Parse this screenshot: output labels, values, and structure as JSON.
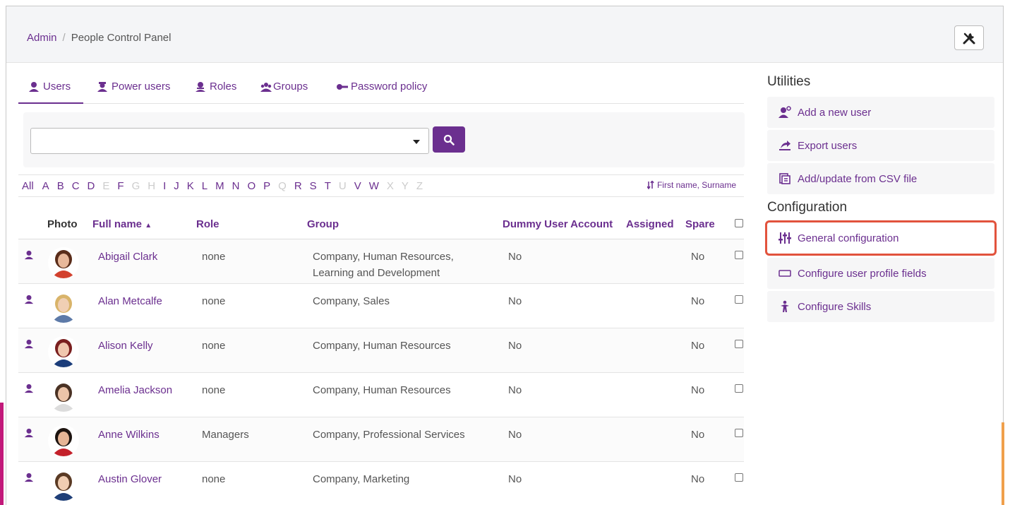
{
  "breadcrumb": {
    "root": "Admin",
    "separator": "/",
    "current": "People Control Panel"
  },
  "tabs": [
    {
      "label": "Users",
      "icon": "user-icon",
      "active": true
    },
    {
      "label": "Power users",
      "icon": "power-user-icon"
    },
    {
      "label": "Roles",
      "icon": "role-icon"
    },
    {
      "label": "Groups",
      "icon": "groups-icon"
    },
    {
      "label": "Password policy",
      "icon": "key-icon"
    }
  ],
  "search": {
    "value": ""
  },
  "alphabet": {
    "all": "All",
    "letters": [
      {
        "l": "A",
        "on": true
      },
      {
        "l": "B",
        "on": true
      },
      {
        "l": "C",
        "on": true
      },
      {
        "l": "D",
        "on": true
      },
      {
        "l": "E",
        "on": false
      },
      {
        "l": "F",
        "on": true
      },
      {
        "l": "G",
        "on": false
      },
      {
        "l": "H",
        "on": false
      },
      {
        "l": "I",
        "on": true
      },
      {
        "l": "J",
        "on": true
      },
      {
        "l": "K",
        "on": true
      },
      {
        "l": "L",
        "on": true
      },
      {
        "l": "M",
        "on": true
      },
      {
        "l": "N",
        "on": true
      },
      {
        "l": "O",
        "on": true
      },
      {
        "l": "P",
        "on": true
      },
      {
        "l": "Q",
        "on": false
      },
      {
        "l": "R",
        "on": true
      },
      {
        "l": "S",
        "on": true
      },
      {
        "l": "T",
        "on": true
      },
      {
        "l": "U",
        "on": false
      },
      {
        "l": "V",
        "on": true
      },
      {
        "l": "W",
        "on": true
      },
      {
        "l": "X",
        "on": false
      },
      {
        "l": "Y",
        "on": false
      },
      {
        "l": "Z",
        "on": false
      }
    ],
    "sort_label": "First name, Surname"
  },
  "table": {
    "headers": {
      "photo": "Photo",
      "full_name": "Full name",
      "role": "Role",
      "group": "Group",
      "dummy": "Dummy User Account",
      "assigned": "Assigned",
      "spare": "Spare"
    },
    "rows": [
      {
        "name": "Abigail Clark",
        "role": "none",
        "group": "Company, Human Resources,",
        "group2": "Learning and Development",
        "dummy": "No",
        "assigned": "",
        "spare": "No",
        "hair": "#5a2d1a",
        "skin": "#e8b89a",
        "shirt": "#d2412e"
      },
      {
        "name": "Alan Metcalfe",
        "role": "none",
        "group": "Company, Sales",
        "group2": "",
        "dummy": "No",
        "assigned": "",
        "spare": "No",
        "hair": "#d9b46a",
        "skin": "#f0cfb4",
        "shirt": "#5d7aa8"
      },
      {
        "name": "Alison Kelly",
        "role": "none",
        "group": "Company, Human Resources",
        "group2": "",
        "dummy": "No",
        "assigned": "",
        "spare": "No",
        "hair": "#7a1f1f",
        "skin": "#f0c7ae",
        "shirt": "#1b3d7a"
      },
      {
        "name": "Amelia Jackson",
        "role": "none",
        "group": "Company, Human Resources",
        "group2": "",
        "dummy": "No",
        "assigned": "",
        "spare": "No",
        "hair": "#4a3224",
        "skin": "#ecc4a8",
        "shirt": "#dcdcdc"
      },
      {
        "name": "Anne Wilkins",
        "role": "Managers",
        "group": "Company, Professional Services",
        "group2": "",
        "dummy": "No",
        "assigned": "",
        "spare": "No",
        "hair": "#1d1410",
        "skin": "#e6b596",
        "shirt": "#c3202a"
      },
      {
        "name": "Austin Glover",
        "role": "none",
        "group": "Company, Marketing",
        "group2": "",
        "dummy": "No",
        "assigned": "",
        "spare": "No",
        "hair": "#5a3a24",
        "skin": "#f0cdb2",
        "shirt": "#1f3f78"
      }
    ]
  },
  "utilities": {
    "title": "Utilities",
    "items": [
      {
        "label": "Add a new user",
        "icon": "add-user-icon"
      },
      {
        "label": "Export users",
        "icon": "export-icon"
      },
      {
        "label": "Add/update from CSV file",
        "icon": "csv-file-icon"
      }
    ]
  },
  "configuration": {
    "title": "Configuration",
    "items": [
      {
        "label": "General configuration",
        "icon": "sliders-icon",
        "highlighted": true
      },
      {
        "label": "Configure user profile fields",
        "icon": "profile-field-icon"
      },
      {
        "label": "Configure Skills",
        "icon": "skills-icon"
      }
    ]
  },
  "colors": {
    "accent": "#6b2f8f",
    "highlight": "#e2533d"
  }
}
